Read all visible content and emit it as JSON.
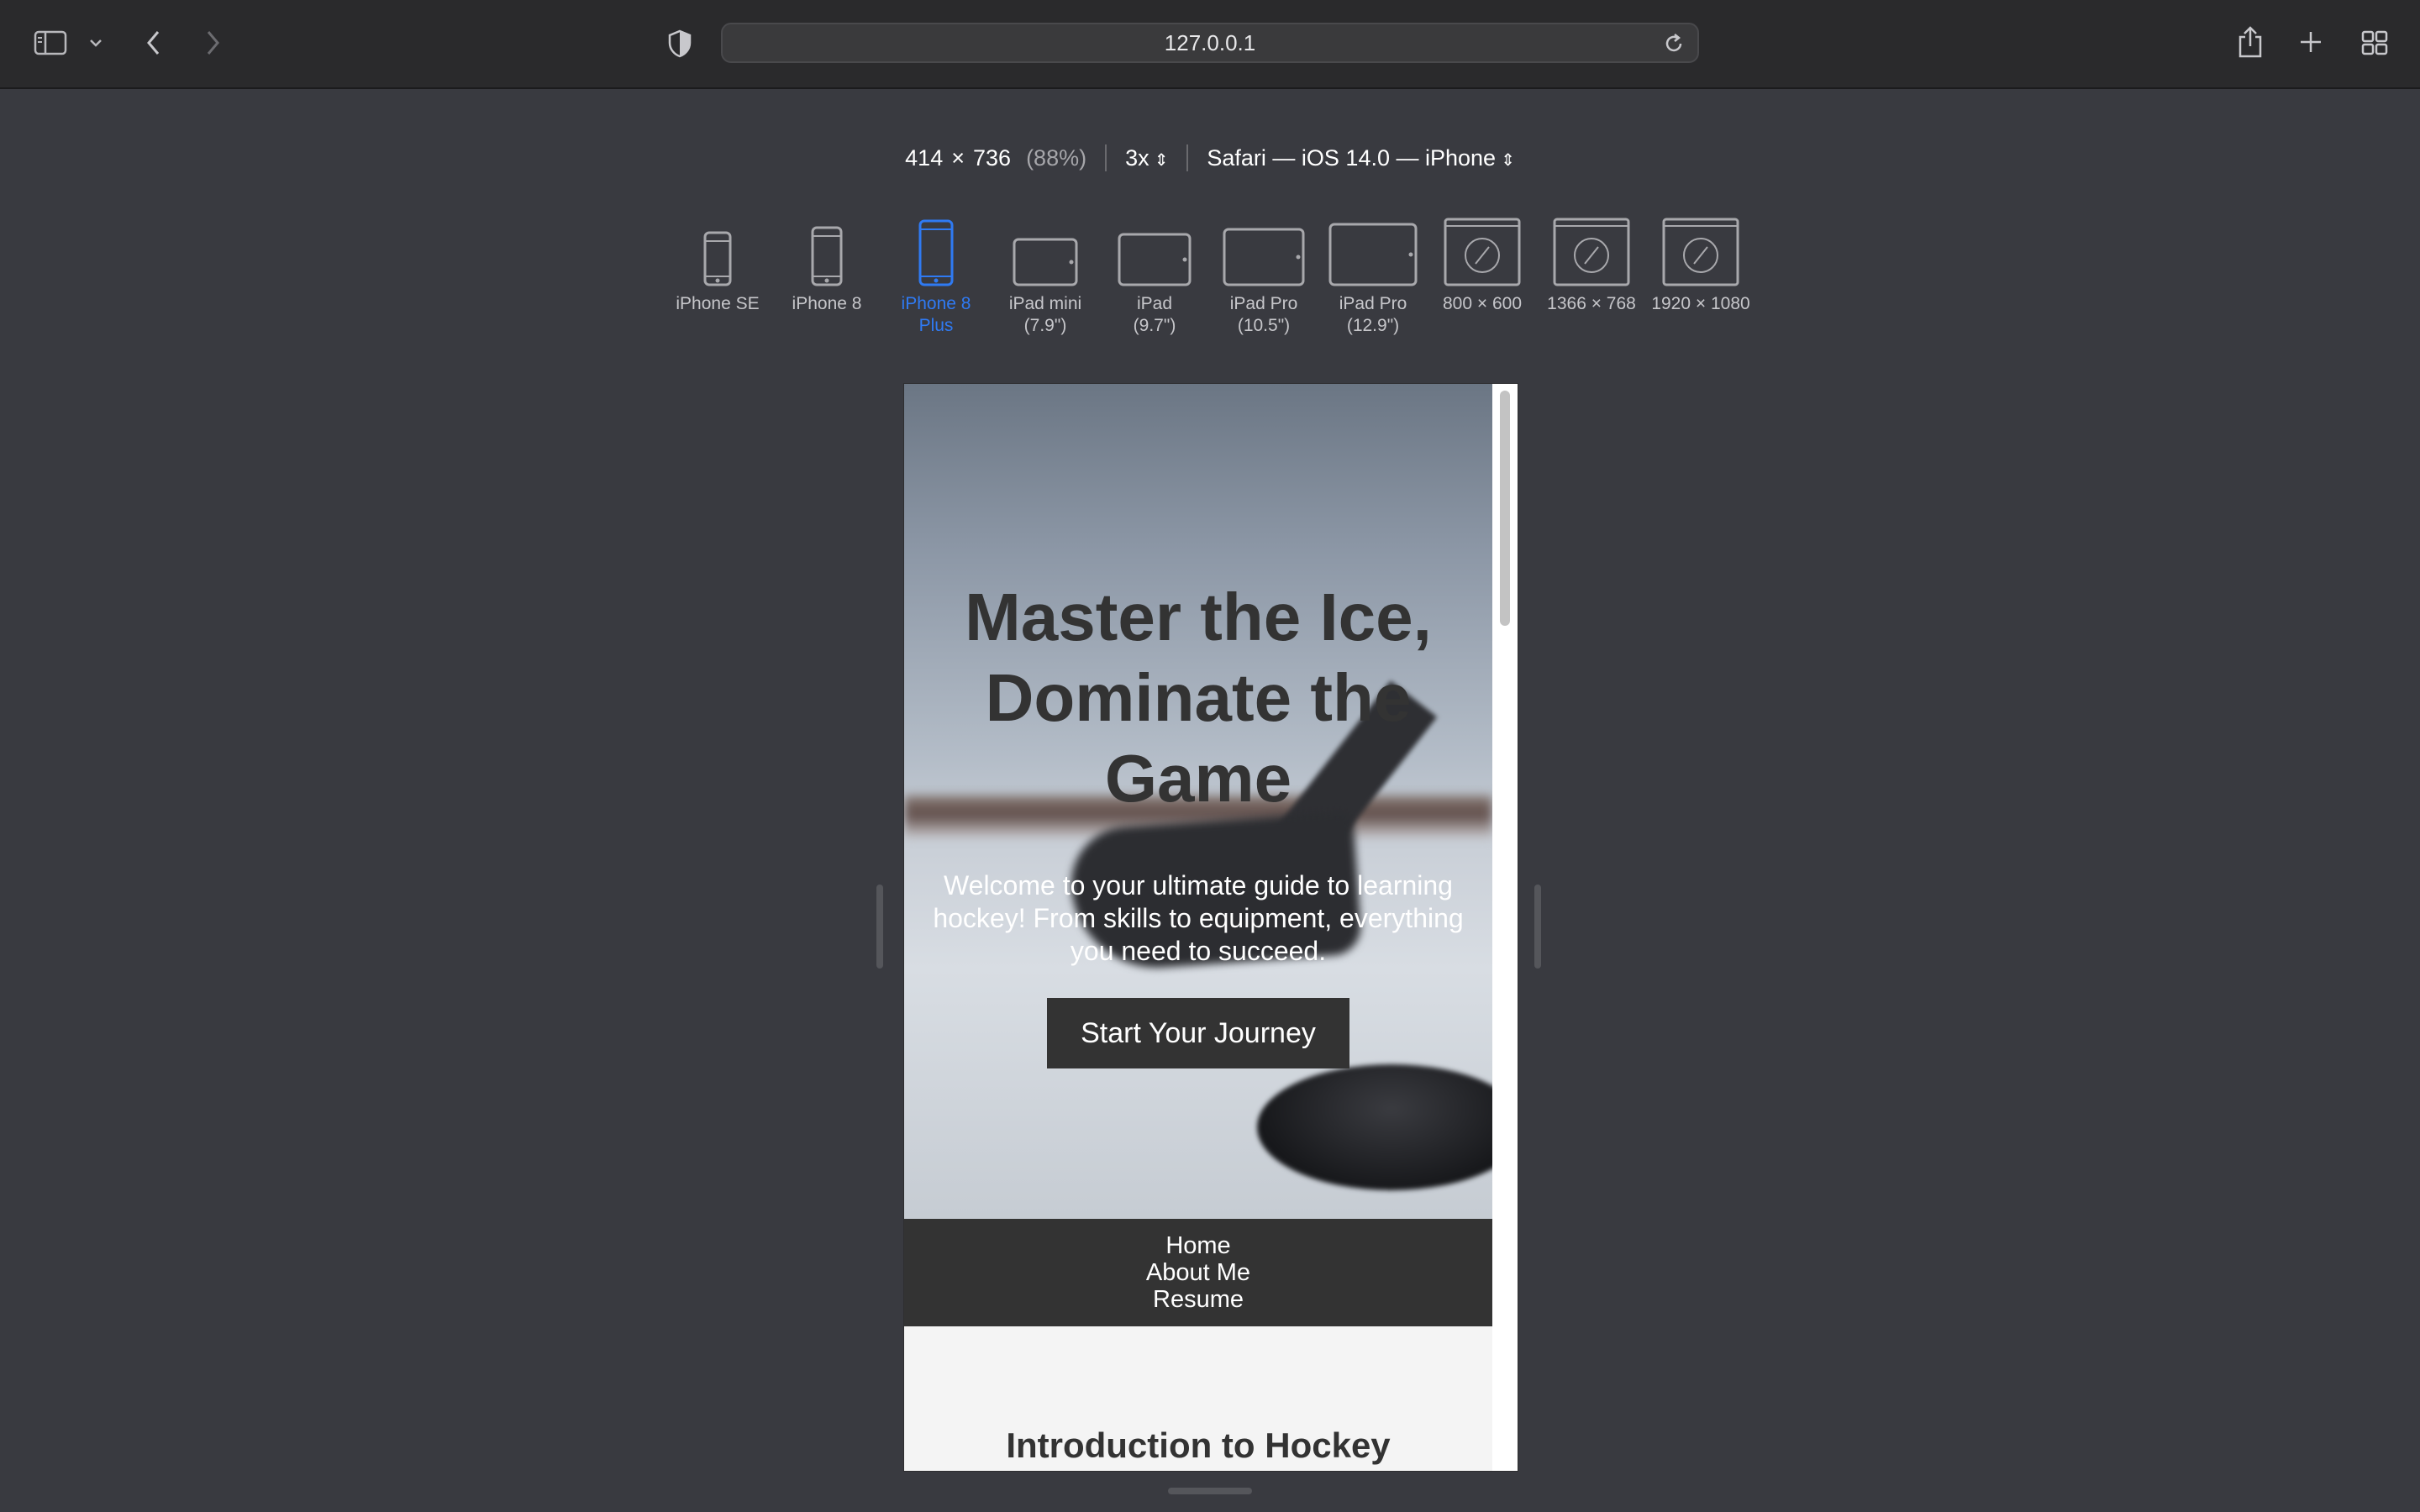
{
  "browser": {
    "url": "127.0.0.1"
  },
  "responsive": {
    "width": "414",
    "times": "×",
    "height": "736",
    "zoom": "(88%)",
    "scale": "3x",
    "user_agent": "Safari — iOS 14.0 — iPhone",
    "devices": [
      {
        "line1": "iPhone SE",
        "line2": "",
        "selected": false
      },
      {
        "line1": "iPhone 8",
        "line2": "",
        "selected": false
      },
      {
        "line1": "iPhone 8",
        "line2": "Plus",
        "selected": true
      },
      {
        "line1": "iPad mini",
        "line2": "(7.9\")",
        "selected": false
      },
      {
        "line1": "iPad",
        "line2": "(9.7\")",
        "selected": false
      },
      {
        "line1": "iPad Pro",
        "line2": "(10.5\")",
        "selected": false
      },
      {
        "line1": "iPad Pro",
        "line2": "(12.9\")",
        "selected": false
      },
      {
        "line1": "800 × 600",
        "line2": "",
        "selected": false
      },
      {
        "line1": "1366 × 768",
        "line2": "",
        "selected": false
      },
      {
        "line1": "1920 × 1080",
        "line2": "",
        "selected": false
      }
    ]
  },
  "site": {
    "hero_title": "Master the Ice, Dominate the Game",
    "hero_subtitle": "Welcome to your ultimate guide to learning hockey! From skills to equipment, everything you need to succeed.",
    "cta_label": "Start Your Journey",
    "nav": [
      "Home",
      "About Me",
      "Resume"
    ],
    "intro_title": "Introduction to Hockey"
  },
  "colors": {
    "accent": "#2f7af3",
    "dark": "#333333",
    "toolbar": "#2a2a2c",
    "background": "#393a40"
  }
}
